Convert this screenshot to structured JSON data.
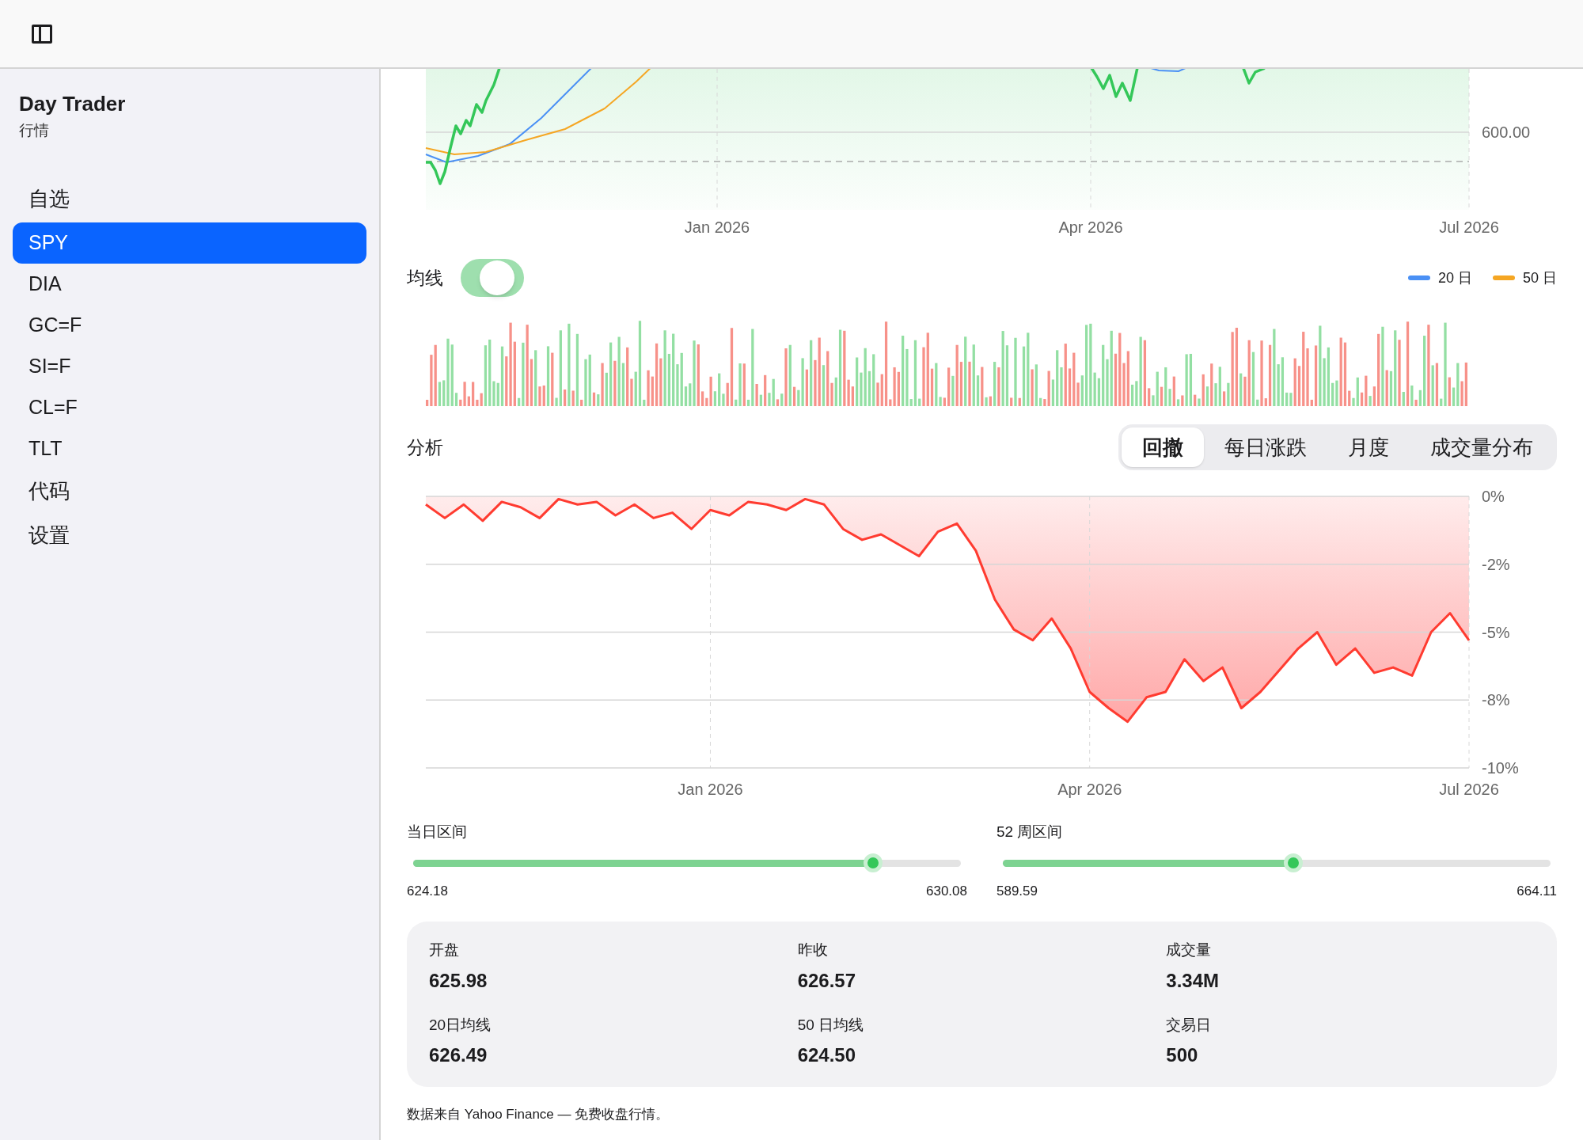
{
  "sidebar": {
    "app_title": "Day Trader",
    "app_subtitle": "行情",
    "section_label": "自选",
    "items": [
      {
        "label": "SPY",
        "selected": true
      },
      {
        "label": "DIA",
        "selected": false
      },
      {
        "label": "GC=F",
        "selected": false
      },
      {
        "label": "SI=F",
        "selected": false
      },
      {
        "label": "CL=F",
        "selected": false
      },
      {
        "label": "TLT",
        "selected": false
      }
    ],
    "links": [
      {
        "label": "代码"
      },
      {
        "label": "设置"
      }
    ]
  },
  "price_chart": {
    "y_tick_labels": [
      "600.00"
    ],
    "x_tick_labels": [
      "Jan 2026",
      "Apr 2026",
      "Jul 2026"
    ]
  },
  "moving_average": {
    "label": "均线",
    "on": true,
    "legend": [
      {
        "label": "20 日",
        "color": "#4a90f5"
      },
      {
        "label": "50 日",
        "color": "#f5a623"
      }
    ]
  },
  "analysis": {
    "label": "分析",
    "tabs": [
      {
        "label": "回撤",
        "selected": true
      },
      {
        "label": "每日涨跌",
        "selected": false
      },
      {
        "label": "月度",
        "selected": false
      },
      {
        "label": "成交量分布",
        "selected": false
      }
    ],
    "chart_data": {
      "type": "area",
      "categories": [
        null,
        null,
        null,
        null,
        null,
        null,
        null,
        null,
        null,
        null,
        null,
        null,
        null,
        null,
        null,
        "Jan 2026",
        null,
        null,
        null,
        null,
        null,
        null,
        null,
        null,
        null,
        null,
        null,
        null,
        null,
        null,
        null,
        null,
        null,
        null,
        null,
        "Apr 2026",
        null,
        null,
        null,
        null,
        null,
        null,
        null,
        null,
        null,
        null,
        null,
        null,
        null,
        null,
        null,
        null,
        null,
        null,
        null,
        "Jul 2026"
      ],
      "series": [
        {
          "color": "#ff3b30",
          "values": [
            -0.3,
            -0.8,
            -0.3,
            -0.9,
            -0.2,
            -0.4,
            -0.8,
            -0.1,
            -0.3,
            -0.2,
            -0.7,
            -0.3,
            -0.8,
            -0.6,
            -1.2,
            -0.5,
            -0.7,
            -0.2,
            -0.3,
            -0.5,
            -0.1,
            -0.3,
            -1.2,
            -1.6,
            -1.4,
            -1.8,
            -2.2,
            -1.3,
            -1.0,
            -2.0,
            -3.8,
            -4.9,
            -5.3,
            -4.5,
            -5.6,
            -7.2,
            -7.8,
            -8.3,
            -7.4,
            -7.2,
            -6.0,
            -6.8,
            -6.3,
            -7.8,
            -7.2,
            -6.4,
            -5.6,
            -5.0,
            -6.2,
            -5.6,
            -6.5,
            -6.3,
            -6.6,
            -5.0,
            -4.3,
            -5.3
          ]
        }
      ],
      "ylim": [
        -10,
        0
      ],
      "grid": true,
      "yticks": [
        {
          "value": 0,
          "label": "0%"
        },
        {
          "value": -2.5,
          "label": "-2%"
        },
        {
          "value": -5,
          "label": "-5%"
        },
        {
          "value": -7.5,
          "label": "-8%"
        },
        {
          "value": -10,
          "label": "-10%"
        }
      ]
    }
  },
  "ranges": [
    {
      "label": "当日区间",
      "level": 0.84,
      "low": "624.18",
      "high": "630.08"
    },
    {
      "label": "52 周区间",
      "level": 0.53,
      "low": "589.59",
      "high": "664.11"
    }
  ],
  "stats": [
    {
      "label": "开盘",
      "value": "625.98"
    },
    {
      "label": "昨收",
      "value": "626.57"
    },
    {
      "label": "成交量",
      "value": "3.34M"
    },
    {
      "label": "20日均线",
      "value": "626.49"
    },
    {
      "label": "50 日均线",
      "value": "624.50"
    },
    {
      "label": "交易日",
      "value": "500"
    }
  ],
  "footnote": "数据来自 Yahoo Finance — 免费收盘行情。"
}
